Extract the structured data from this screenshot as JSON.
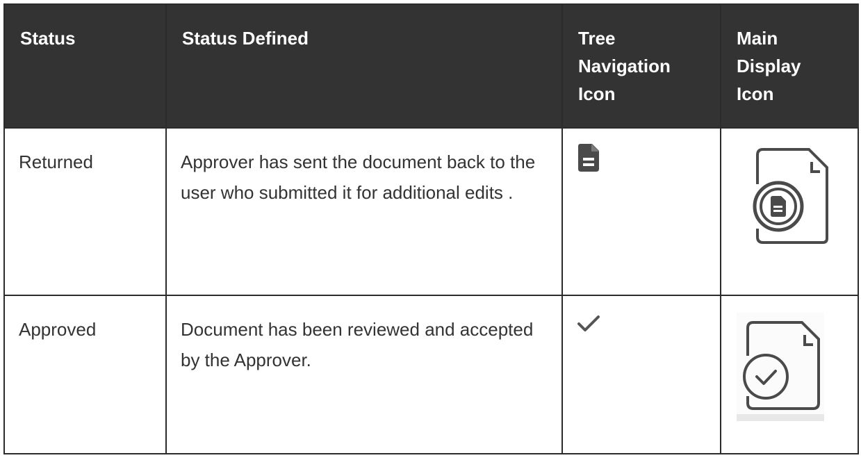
{
  "headers": {
    "status": "Status",
    "defined": "Status Defined",
    "tree": [
      "Tree",
      "Navigation",
      "Icon"
    ],
    "main": [
      "Main",
      "Display",
      "Icon"
    ]
  },
  "rows": [
    {
      "status": "Returned",
      "defined": "Approver has sent the document back to the user who submitted it for additional edits .",
      "tree_icon": "document-lines-icon",
      "main_icon": "document-returned-icon"
    },
    {
      "status": "Approved",
      "defined": "Document has been reviewed and accepted by the Approver.",
      "tree_icon": "checkmark-icon",
      "main_icon": "document-approved-icon"
    }
  ]
}
